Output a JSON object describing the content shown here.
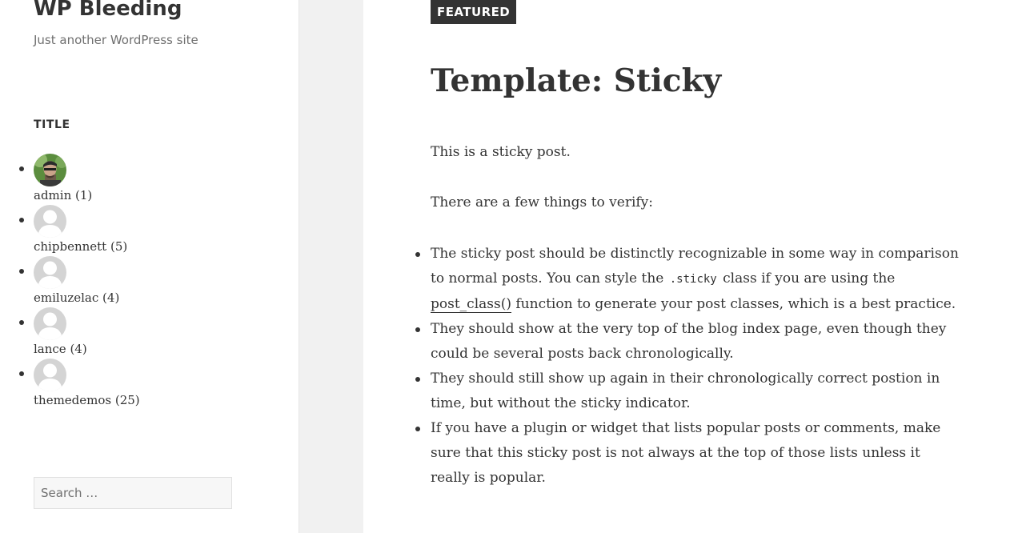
{
  "site": {
    "title": "WP Bleeding",
    "description": "Just another WordPress site"
  },
  "sidebar": {
    "widget_title": "TITLE",
    "authors": [
      {
        "name": "admin (1)",
        "avatar": "photo"
      },
      {
        "name": "chipbennett (5)",
        "avatar": "default"
      },
      {
        "name": "emiluzelac (4)",
        "avatar": "default"
      },
      {
        "name": "lance (4)",
        "avatar": "default"
      },
      {
        "name": "themedemos (25)",
        "avatar": "default"
      }
    ],
    "search": {
      "placeholder": "Search …"
    }
  },
  "post": {
    "badge": "FEATURED",
    "title": "Template: Sticky",
    "p1": "This is a sticky post.",
    "p2": "There are a few things to verify:",
    "bullets": {
      "b1_a": "The sticky post should be distinctly recognizable in some way in comparison to normal posts. You can style the ",
      "b1_code": ".sticky",
      "b1_b": " class if you are using the ",
      "b1_link": "post_class()",
      "b1_c": " function to generate your post classes, which is a best practice.",
      "b2": "They should show at the very top of the blog index page, even though they could be several posts back chronologically.",
      "b3": "They should still show up again in their chronologically correct postion in time, but without the sticky indicator.",
      "b4": "If you have a plugin or widget that lists popular posts or comments, make sure that this sticky post is not always at the top of those lists unless it really is popular."
    }
  },
  "colors": {
    "text": "#333333",
    "muted": "#707070",
    "badge_bg": "#333333",
    "page_bg": "#f1f1f1"
  }
}
